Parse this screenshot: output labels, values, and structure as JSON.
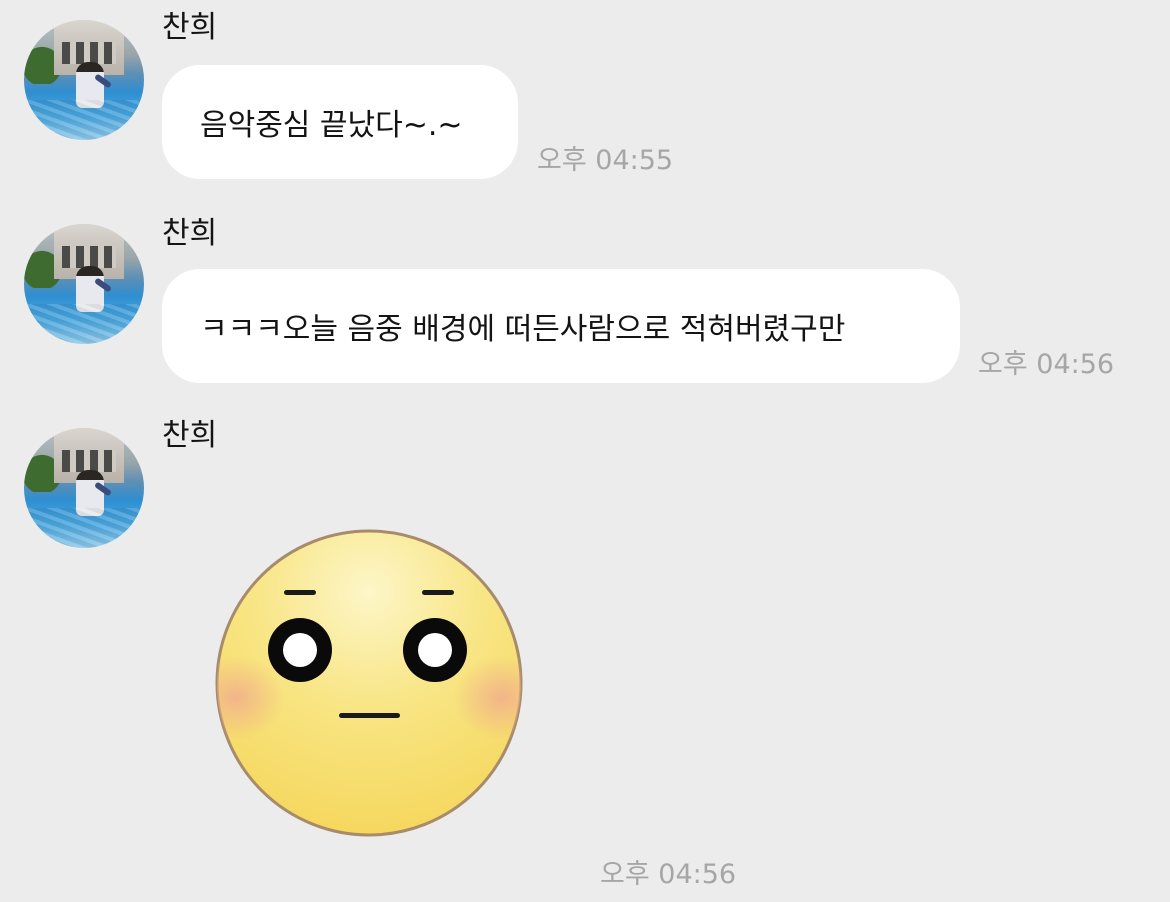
{
  "messages": [
    {
      "sender": "찬희",
      "text": "음악중심 끝났다~.~",
      "time": "오후 04:55"
    },
    {
      "sender": "찬희",
      "text": "ㅋㅋㅋ오늘 음중 배경에 떠든사람으로 적혀버렸구만",
      "time": "오후 04:56"
    },
    {
      "sender": "찬희",
      "emoticon": "blank-stare-face-emoticon",
      "time": "오후 04:56"
    }
  ],
  "colors": {
    "background": "#ececed",
    "bubble": "#ffffff",
    "timestamp": "#a6a6a6",
    "emoticon_face": "#f7dd6b",
    "emoticon_outline": "#a88b6a",
    "emoticon_blush": "#f2b28b"
  }
}
